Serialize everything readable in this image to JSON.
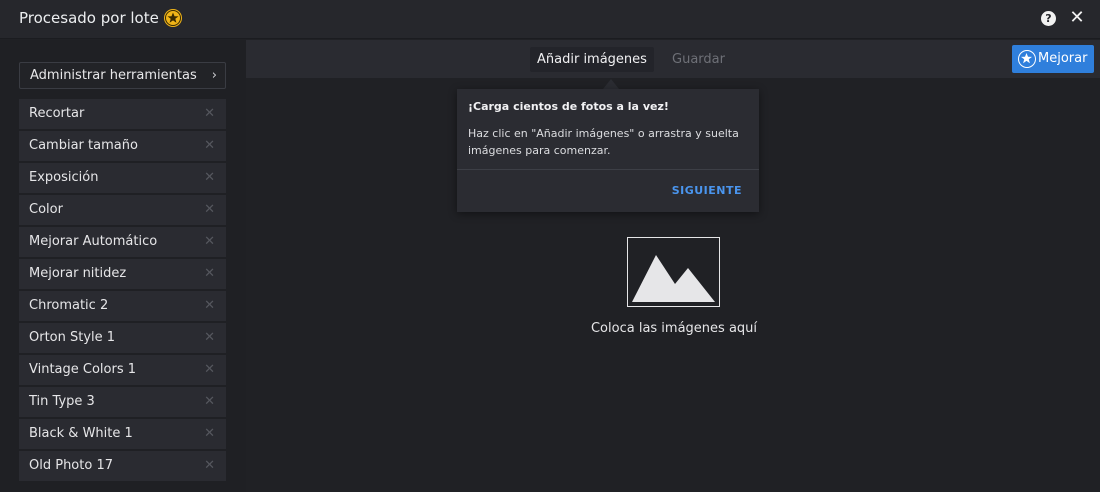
{
  "titlebar": {
    "title": "Procesado por lote",
    "help_icon": "question-circle-icon",
    "close_icon": "close-icon"
  },
  "sidebar": {
    "manage_tools_label": "Administrar herramientas",
    "manage_tools_chevron": "›",
    "tools": [
      {
        "label": "Recortar"
      },
      {
        "label": "Cambiar tamaño"
      },
      {
        "label": "Exposición"
      },
      {
        "label": "Color"
      },
      {
        "label": "Mejorar Automático"
      },
      {
        "label": "Mejorar nitidez"
      },
      {
        "label": "Chromatic 2"
      },
      {
        "label": "Orton Style 1"
      },
      {
        "label": "Vintage Colors 1"
      },
      {
        "label": "Tin Type 3"
      },
      {
        "label": "Black & White 1"
      },
      {
        "label": "Old Photo 17"
      }
    ],
    "remove_glyph": "✕"
  },
  "toolbar": {
    "add_images_label": "Añadir imágenes",
    "save_label": "Guardar",
    "enhance_label": "Mejorar"
  },
  "tooltip": {
    "title": "¡Carga cientos de fotos a la vez!",
    "body": "Haz clic en \"Añadir imágenes\" o arrastra y suelta imágenes para comenzar.",
    "next_label": "SIGUIENTE"
  },
  "dropzone": {
    "text": "Coloca las imágenes aquí",
    "icon": "image-placeholder-icon"
  },
  "colors": {
    "accent_blue": "#2f7fdc",
    "premium_gold": "#f0b418",
    "link_blue": "#4a95ee",
    "background": "#202125"
  }
}
